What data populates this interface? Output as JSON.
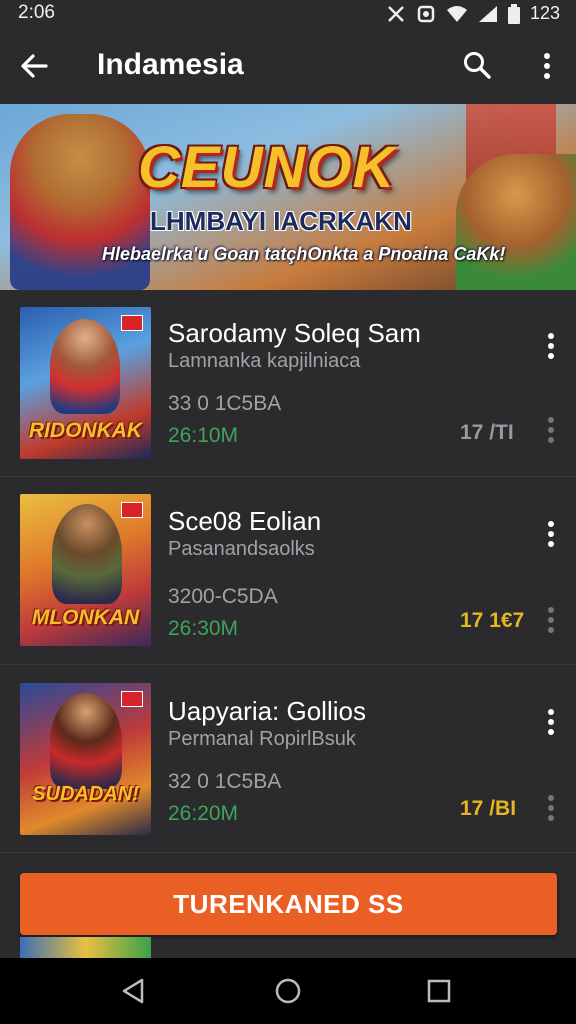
{
  "status_bar": {
    "time": "2:06",
    "battery_text": "123"
  },
  "app_bar": {
    "title": "Indamesia"
  },
  "banner": {
    "title": "CEUNOK",
    "subtitle": "LHMBAYI IACRKAKN",
    "tagline": "Hlebaelrka'u Goan tatçhOnkta a Pnoaina CaKk!"
  },
  "items": [
    {
      "name": "Sarodamy Soleq Sam",
      "developer": "Lamnanka kapjilniaca",
      "size": "33 0 1C5BA",
      "downloads": "26:10M",
      "rating": "17 /TI",
      "rating_color": "#9a9a9e",
      "thumb_logo": "RIDONKAK"
    },
    {
      "name": "Sce08 Eolian",
      "developer": "Pasanandsaolks",
      "size": "3200-C5DA",
      "downloads": "26:30M",
      "rating": "17 1€7",
      "rating_color": "#e5b622",
      "thumb_logo": "MLONKAN"
    },
    {
      "name": "Uapyaria: Gollios",
      "developer": "Permanal RopirlBsuk",
      "size": "32 0 1C5BA",
      "downloads": "26:20M",
      "rating": "17 /BI",
      "rating_color": "#e5b622",
      "thumb_logo": "SUDADAN!"
    }
  ],
  "cta": {
    "label": "TURENKANED SS"
  },
  "icons": {
    "back": "arrow-left-icon",
    "search": "search-icon",
    "more": "more-vert-icon",
    "nav_back": "nav-back-icon",
    "nav_home": "nav-home-icon",
    "nav_recents": "nav-recents-icon"
  },
  "colors": {
    "accent": "#ea5f24",
    "download_green": "#3fa35a",
    "background": "#2b2b2d"
  }
}
